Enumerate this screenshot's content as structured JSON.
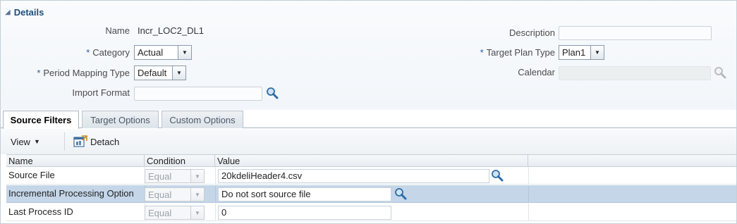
{
  "details": {
    "title": "Details",
    "name_label": "Name",
    "name_value": "Incr_LOC2_DL1",
    "category_label": "Category",
    "category_value": "Actual",
    "period_mapping_label": "Period Mapping Type",
    "period_mapping_value": "Default",
    "import_format_label": "Import Format",
    "import_format_value": "",
    "description_label": "Description",
    "description_value": "",
    "target_plan_type_label": "Target Plan Type",
    "target_plan_type_value": "Plan1",
    "calendar_label": "Calendar",
    "calendar_value": "",
    "required_marker": "*"
  },
  "tabs": [
    {
      "label": "Source Filters",
      "active": true
    },
    {
      "label": "Target Options",
      "active": false
    },
    {
      "label": "Custom Options",
      "active": false
    }
  ],
  "toolbar": {
    "view_label": "View",
    "detach_label": "Detach"
  },
  "table": {
    "columns": [
      "Name",
      "Condition",
      "Value"
    ],
    "rows": [
      {
        "name": "Source File",
        "condition": "Equal",
        "value": "20kdeliHeader4.csv",
        "selected": false
      },
      {
        "name": "Incremental Processing Option",
        "condition": "Equal",
        "value": "Do not sort source file",
        "selected": true
      },
      {
        "name": "Last Process ID",
        "condition": "Equal",
        "value": "0",
        "selected": false
      }
    ]
  },
  "icons": {
    "search": "search-icon",
    "collapse": "collapse-triangle-icon",
    "dropdown": "chevron-down-icon",
    "detach": "detach-icon"
  },
  "colors": {
    "header_text": "#1e4d7a",
    "selected_row": "#c4d6e8",
    "required_star": "#2a5b9c"
  }
}
